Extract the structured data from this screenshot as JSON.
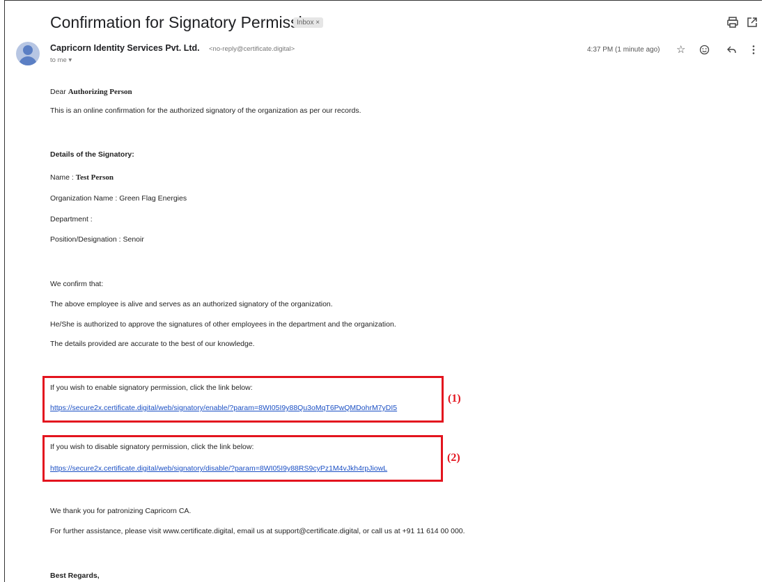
{
  "email": {
    "subject": "Confirmation for Signatory Permission",
    "label_chip": "Inbox ×",
    "sender_name": "Capricorn Identity Services Pvt. Ltd.",
    "sender_email": "<no-reply@certificate.digital>",
    "recipient": "to me ▾",
    "time": "4:37 PM (1 minute ago)"
  },
  "icons": {
    "print": "printer-icon",
    "open_new_window": "open-in-new-window-icon",
    "star": "star-icon",
    "emoji": "emoji-reaction-icon",
    "reply": "reply-icon",
    "more": "more-vertical-icon"
  },
  "body": {
    "greeting_prefix": "Dear",
    "greeting_name": "Authorizing Person",
    "intro": "This is an online confirmation for the authorized signatory of the organization as per our records.",
    "details_heading": "Details of the Signatory:",
    "name_label": "Name :",
    "name_value": "Test Person",
    "organization": "Organization Name : Green Flag Energies",
    "department": "Department :",
    "position": "Position/Designation : Senoir",
    "confirm_heading": "We confirm that:",
    "confirm_1": "The above employee is alive and serves as an authorized signatory of the organization.",
    "confirm_2": "He/She is authorized to approve the signatures of other employees in the department and the organization.",
    "confirm_3": "The details provided are accurate to the best of our knowledge.",
    "enable_text": "If you wish to enable signatory permission, click the link below:",
    "enable_link": "https://secure2x.certificate.digital/web/signatory/enable/?param=8WI05I9y88Qu3oMqT6PwQMDohrM7yDI5",
    "disable_text": "If you wish to disable signatory permission, click the link below:",
    "disable_link": "https://secure2x.certificate.digital/web/signatory/disable/?param=8WI05I9y88RS9cyPz1M4vJkh4rpJiowL",
    "thanks": "We thank you for patronizing Capricorn CA.",
    "assistance": "For further assistance, please visit www.certificate.digital, email us at support@certificate.digital, or call us at +91 11 614 00 000.",
    "signoff": "Best Regards,"
  },
  "annotations": {
    "marker_1": "(1)",
    "marker_2": "(2)",
    "box_color": "#e3141e"
  }
}
